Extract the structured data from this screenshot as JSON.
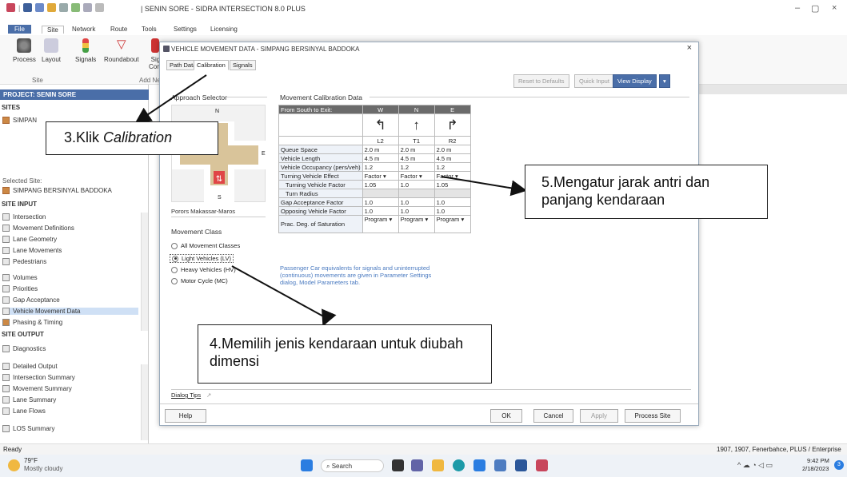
{
  "window": {
    "title": "| SENIN SORE - SIDRA INTERSECTION 8.0 PLUS",
    "minimize": "–",
    "restore": "▢",
    "close": "×"
  },
  "ribbon": {
    "tabs": [
      "File",
      "Site",
      "Network",
      "Route",
      "Tools",
      "Settings",
      "Licensing"
    ],
    "buttons": [
      "Process",
      "Layout",
      "Signals",
      "Roundabout",
      "Sig",
      "Cont"
    ],
    "groups": [
      "Site",
      "Add Ne"
    ]
  },
  "left_panel": {
    "project_header": "PROJECT: SENIN SORE",
    "sites_label": "SITES",
    "site_item": "SIMPAN",
    "selected_site_label": "Selected Site:",
    "selected_site_value": "SIMPANG BERSINYAL BADDOKA",
    "site_input_label": "SITE INPUT",
    "site_input_items": [
      "Intersection",
      "Movement Definitions",
      "Lane Geometry",
      "Lane Movements",
      "Pedestrians",
      "Volumes",
      "Priorities",
      "Gap Acceptance",
      "Vehicle Movement Data",
      "Phasing & Timing"
    ],
    "site_output_label": "SITE OUTPUT",
    "site_output_items": [
      "Diagnostics",
      "Detailed Output",
      "Intersection Summary",
      "Movement Summary",
      "Lane Summary",
      "Lane Flows",
      "LOS Summary"
    ]
  },
  "dialog": {
    "title": "VEHICLE MOVEMENT DATA - SIMPANG BERSINYAL BADDOKA",
    "close": "×",
    "tabs": [
      "Path Data",
      "Calibration",
      "Signals"
    ],
    "top_buttons": [
      "Reset to Defaults",
      "Quick Input",
      "View Display"
    ],
    "approach_selector": "Approach Selector",
    "compass": {
      "n": "N",
      "e": "E",
      "s": "S"
    },
    "approach_name": "Porors Makassar-Maros",
    "movement_class_title": "Movement Class",
    "movement_classes": [
      "All Movement Classes",
      "Light Vehicles (LV)",
      "Heavy Vehicles (HV)",
      "Motor Cycle (MC)"
    ],
    "selected_class_index": 1,
    "calibration_title": "Movement Calibration Data",
    "table": {
      "corner": "From South to Exit:",
      "columns": [
        "W",
        "N",
        "E"
      ],
      "arrows": [
        "↰",
        "↑",
        "↱"
      ],
      "codes": [
        "L2",
        "T1",
        "R2"
      ],
      "rows": [
        {
          "label": "Queue Space",
          "values": [
            "2.0 m",
            "2.0 m",
            "2.0 m"
          ]
        },
        {
          "label": "Vehicle Length",
          "values": [
            "4.5 m",
            "4.5 m",
            "4.5 m"
          ]
        },
        {
          "label": "Vehicle Occupancy (pers/veh)",
          "values": [
            "1.2",
            "1.2",
            "1.2"
          ]
        },
        {
          "label": "Turning Vehicle Effect",
          "values": [
            "Factor ▾",
            "Factor ▾",
            "Factor ▾"
          ]
        },
        {
          "label": "Turning Vehicle Factor",
          "values": [
            "1.05",
            "1.0",
            "1.05"
          ]
        },
        {
          "label": "Turn Radius",
          "values": [
            "",
            "",
            ""
          ]
        },
        {
          "label": "Gap Acceptance Factor",
          "values": [
            "1.0",
            "1.0",
            "1.0"
          ]
        },
        {
          "label": "Opposing Vehicle Factor",
          "values": [
            "1.0",
            "1.0",
            "1.0"
          ]
        },
        {
          "label": "Prac. Deg. of Saturation",
          "values": [
            "Program ▾",
            "Program ▾",
            "Program ▾"
          ]
        }
      ]
    },
    "note": "Passenger Car equivalents for signals and uninterrupted (continuous) movements are given in Parameter Settings dialog, Model Parameters tab.",
    "dialog_tips": "Dialog Tips",
    "footer_buttons": [
      "Help",
      "OK",
      "Cancel",
      "Apply",
      "Process Site"
    ]
  },
  "annotations": {
    "step3": "3.Klik ",
    "step3_em": "Calibration",
    "step4": "4.Memilih jenis kendaraan untuk diubah dimensi",
    "step5": "5.Mengatur jarak antri dan panjang kendaraan"
  },
  "status": {
    "left": "Ready",
    "right": "1907, 1907, Fenerbahce, PLUS / Enterprise"
  },
  "taskbar": {
    "weather_temp": "79°F",
    "weather_desc": "Mostly cloudy",
    "search": "Search",
    "time": "9:42 PM",
    "date": "2/18/2023",
    "notif_count": "3"
  },
  "colors": {
    "accent": "#4a6ea8",
    "road": "#d9c49a",
    "signal_red": "#e04646",
    "link_blue": "#4a7ac0"
  }
}
